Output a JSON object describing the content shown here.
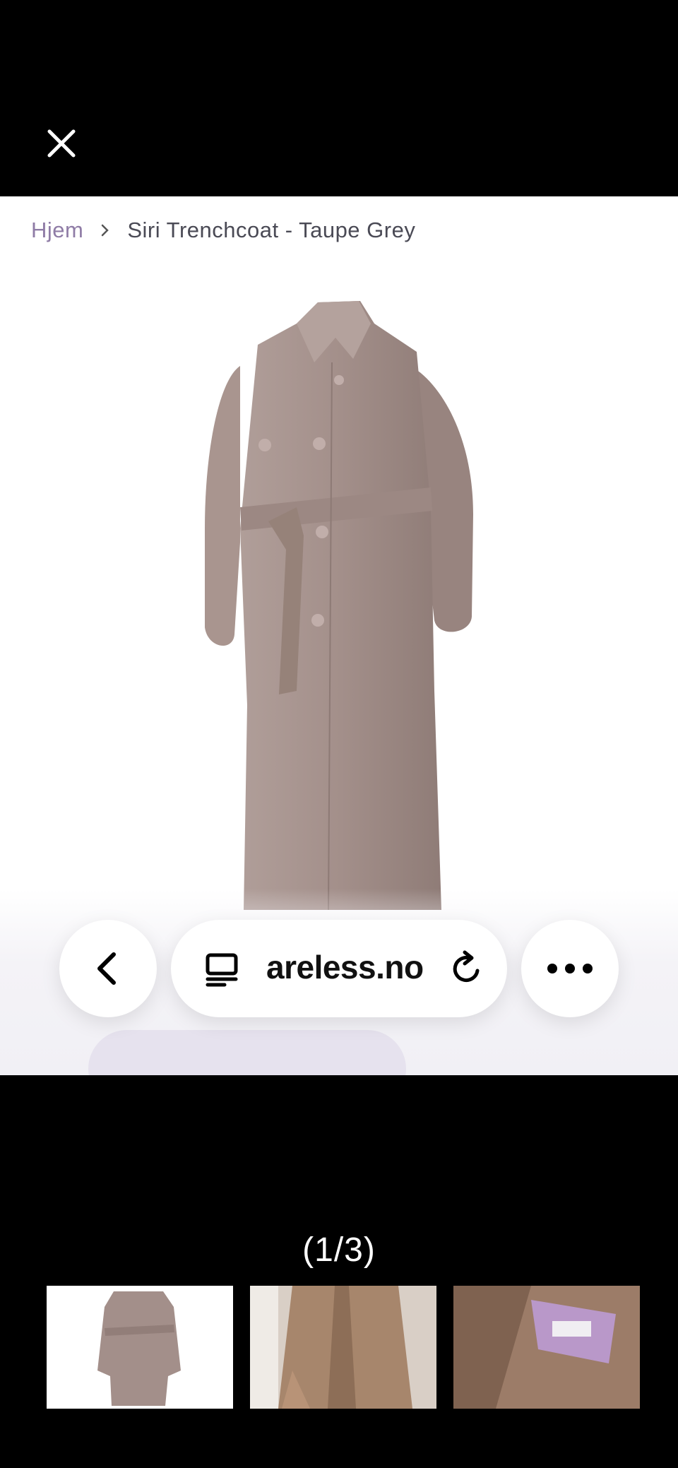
{
  "viewer": {
    "close_icon": "close-icon",
    "counter": "(1/3)"
  },
  "breadcrumb": {
    "home": "Hjem",
    "separator_icon": "chevron-right-icon",
    "current": "Siri Trenchcoat - Taupe Grey"
  },
  "product_image": {
    "alt": "Siri Trenchcoat - Taupe Grey",
    "color": "#a89590"
  },
  "browser_bar": {
    "back_icon": "chevron-left-icon",
    "tabs_icon": "tabs-icon",
    "url": "areless.no",
    "reload_icon": "reload-icon",
    "more_icon": "more-icon"
  },
  "carousel": {
    "dot_count": 7,
    "active_index": 1
  },
  "thumbnails": [
    {
      "name": "thumbnail-1",
      "selected": true
    },
    {
      "name": "thumbnail-2",
      "selected": false
    },
    {
      "name": "thumbnail-3",
      "selected": false
    }
  ]
}
